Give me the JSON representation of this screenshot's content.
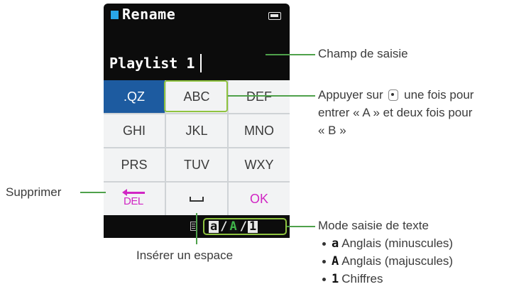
{
  "device": {
    "title": "Rename",
    "input_value": "Playlist 1",
    "keys": [
      [
        ".QZ",
        "ABC",
        "DEF"
      ],
      [
        "GHI",
        "JKL",
        "MNO"
      ],
      [
        "PRS",
        "TUV",
        "WXY"
      ]
    ],
    "del_label": "DEL",
    "ok_label": "OK",
    "mode_indicator": {
      "lower": "a",
      "upper": "A",
      "digits": "1",
      "separator": "/"
    },
    "colors": {
      "selected_key": "#1d5ba0",
      "accent_magenta": "#d126c4",
      "highlight_green": "#8fc33f",
      "title_marker": "#29a6e8"
    }
  },
  "annotations": {
    "input_field": "Champ de saisie",
    "press_key_line1_a": "Appuyer sur",
    "press_key_line1_b": "une fois pour",
    "press_key_line2": "entrer « A » et deux fois pour",
    "press_key_line3": "« B »",
    "delete": "Supprimer",
    "insert_space": "Insérer un espace",
    "text_mode": "Mode saisie de texte",
    "modes": [
      {
        "glyph": "a",
        "label": "Anglais (minuscules)"
      },
      {
        "glyph": "A",
        "label": "Anglais (majuscules)"
      },
      {
        "glyph": "1",
        "label": "Chiffres"
      }
    ]
  }
}
